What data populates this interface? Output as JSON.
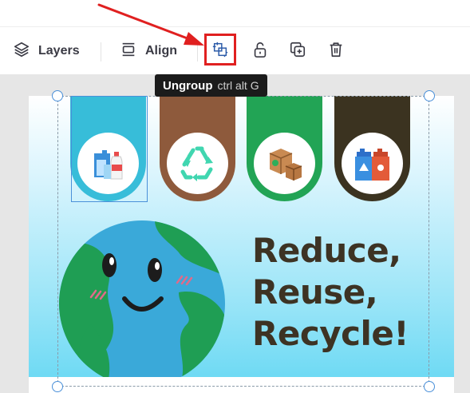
{
  "toolbar": {
    "layers_label": "Layers",
    "align_label": "Align",
    "buttons": [
      "ungroup",
      "lock",
      "duplicate",
      "delete"
    ],
    "layers_icon": "layers-icon",
    "align_icon": "align-icon",
    "ungroup_icon": "ungroup-icon",
    "lock_icon": "unlock-icon",
    "duplicate_icon": "duplicate-icon",
    "delete_icon": "trash-icon"
  },
  "tooltip": {
    "label": "Ungroup",
    "shortcut": "ctrl alt G"
  },
  "annotation": {
    "arrow_color": "#e02020",
    "highlight_color": "#e02020"
  },
  "design": {
    "headline_line1": "Reduce,",
    "headline_line2": "Reuse,",
    "headline_line3": "Recycle!",
    "banner_colors": [
      "#37bdd9",
      "#8e5a3c",
      "#22a455",
      "#3b3320"
    ],
    "banner_icons": [
      "plastic-bottles-icon",
      "recycle-symbol-icon",
      "cardboard-boxes-icon",
      "recycling-bins-icon"
    ],
    "globe_icon": "smiling-earth-icon"
  },
  "colors": {
    "selection": "#4a90d9",
    "headline": "#3d3324"
  }
}
